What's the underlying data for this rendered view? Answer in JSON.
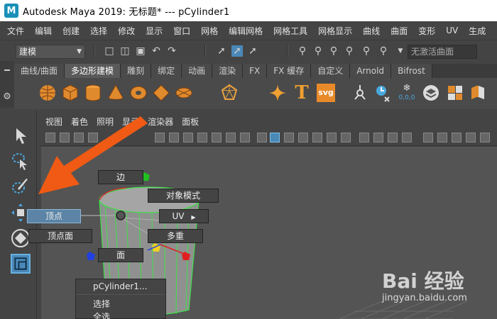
{
  "window": {
    "title": "Autodesk Maya 2019: 无标题*   ---   pCylinder1",
    "logo_letter": "M"
  },
  "menubar": {
    "items": [
      "文件",
      "编辑",
      "创建",
      "选择",
      "修改",
      "显示",
      "窗口",
      "网格",
      "编辑网格",
      "网格工具",
      "网格显示",
      "曲线",
      "曲面",
      "变形",
      "UV",
      "生成"
    ]
  },
  "statusline": {
    "mode": "建模",
    "inactive_surface": "无激活曲面"
  },
  "shelf": {
    "tabs": [
      "曲线/曲面",
      "多边形建模",
      "雕刻",
      "绑定",
      "动画",
      "渲染",
      "FX",
      "FX 缓存",
      "自定义",
      "Arnold",
      "Bifrost"
    ],
    "active_tab": "多边形建模",
    "text_icon": "T",
    "svg_icon": "svg",
    "counter_icon": "0,0,0"
  },
  "panel": {
    "menu": [
      "视图",
      "着色",
      "照明",
      "显示",
      "渲染器",
      "面板"
    ]
  },
  "marking_menu": {
    "edge": "边",
    "object_mode": "对象模式",
    "vertex": "顶点",
    "uv": "UV",
    "vertex_face": "顶点面",
    "multi": "多重",
    "face": "面"
  },
  "context_menu": {
    "header": "pCylinder1...",
    "items": [
      "选择",
      "全选"
    ]
  },
  "watermark": {
    "brand": "Bai 经验",
    "url": "jingyan.baidu.com"
  },
  "colors": {
    "accent": "#4a88b8",
    "arrow": "#f05a14",
    "mesh_green": "#3fe04a"
  }
}
